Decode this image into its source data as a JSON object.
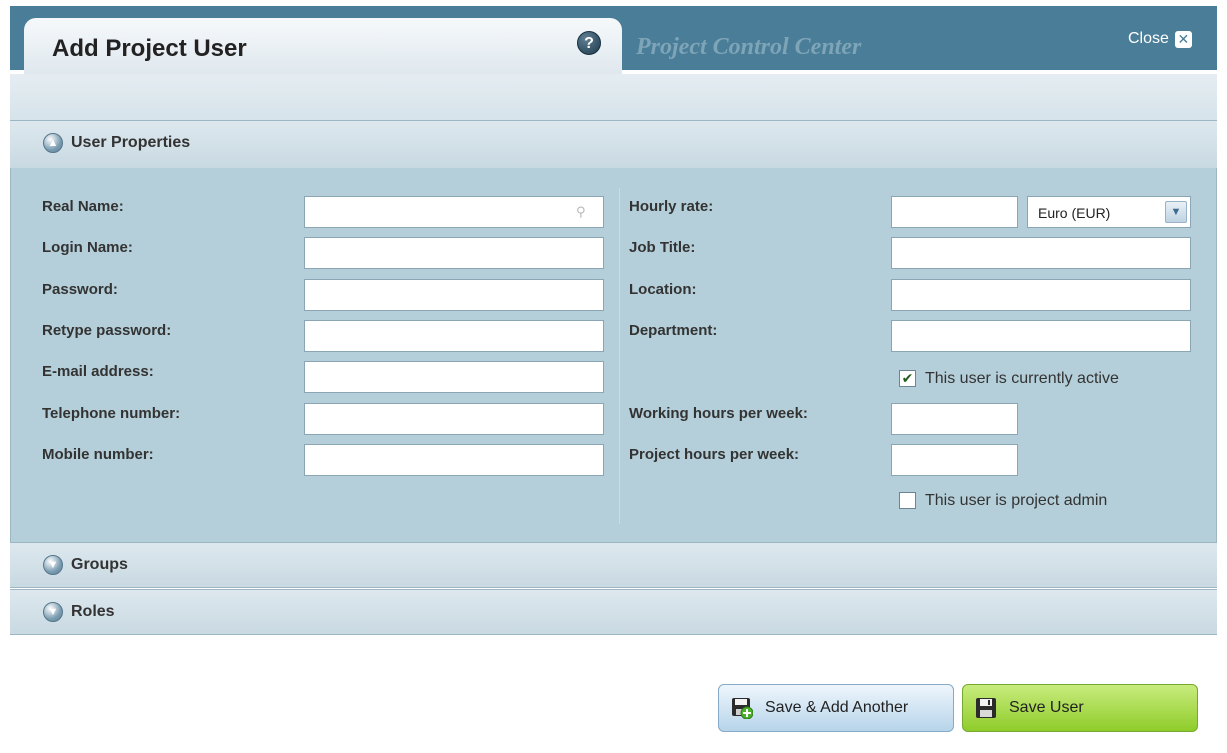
{
  "header": {
    "dialog_title": "Add Project User",
    "help_label": "?",
    "app_title": "Project Control Center",
    "close_label": "Close"
  },
  "sections": {
    "user_properties": "User Properties",
    "groups": "Groups",
    "roles": "Roles"
  },
  "form": {
    "left": {
      "real_name": {
        "label": "Real Name:",
        "value": ""
      },
      "login_name": {
        "label": "Login Name:",
        "value": ""
      },
      "password": {
        "label": "Password:",
        "value": ""
      },
      "retype_password": {
        "label": "Retype password:",
        "value": ""
      },
      "email": {
        "label": "E-mail address:",
        "value": ""
      },
      "telephone": {
        "label": "Telephone number:",
        "value": ""
      },
      "mobile": {
        "label": "Mobile number:",
        "value": ""
      }
    },
    "right": {
      "hourly_rate": {
        "label": "Hourly rate:",
        "value": "",
        "currency": "Euro (EUR)"
      },
      "job_title": {
        "label": "Job Title:",
        "value": ""
      },
      "location": {
        "label": "Location:",
        "value": ""
      },
      "department": {
        "label": "Department:",
        "value": ""
      },
      "active": {
        "label": "This user is currently active",
        "checked": true
      },
      "working_hours": {
        "label": "Working hours per week:",
        "value": ""
      },
      "project_hours": {
        "label": "Project hours per week:",
        "value": ""
      },
      "project_admin": {
        "label": "This user is project admin",
        "checked": false
      }
    }
  },
  "buttons": {
    "save_add_another": "Save & Add Another",
    "save_user": "Save User"
  },
  "colors": {
    "header_bar": "#4a7d97",
    "form_panel": "#b4cfd9",
    "save_button": "#a8dc4a",
    "secondary_button": "#cfe3f2"
  },
  "icons": {
    "help": "help-icon",
    "close": "close-icon",
    "section": "section-expand-icon",
    "search": "search-icon",
    "dropdown": "chevron-down-icon",
    "save_add": "save-add-icon",
    "save": "floppy-disk-icon"
  }
}
